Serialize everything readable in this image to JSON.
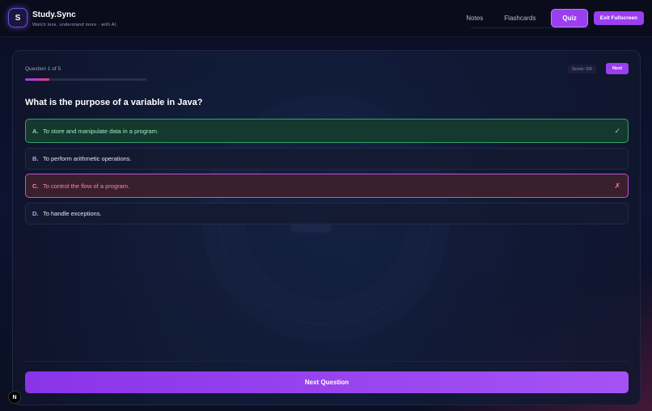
{
  "header": {
    "logo_letter": "S",
    "brand": "Study.Sync",
    "tagline": "Watch less, understand more - with AI.",
    "tabs": [
      {
        "label": "Notes",
        "active": false
      },
      {
        "label": "Flashcards",
        "active": false
      },
      {
        "label": "Quiz",
        "active": true
      }
    ],
    "exit_label": "Exit Fullscreen"
  },
  "quiz": {
    "counter": "Question 1 of 5",
    "progress_fraction": 0.2,
    "score": "Score: 0/5",
    "next_label": "Next",
    "question": "What is the purpose of a variable in Java?",
    "options": [
      {
        "letter": "A.",
        "text": "To store and manipulate data in a program.",
        "state": "correct",
        "mark": "✓"
      },
      {
        "letter": "B.",
        "text": "To perform arithmetic operations.",
        "state": "neutral",
        "mark": ""
      },
      {
        "letter": "C.",
        "text": "To control the flow of a program.",
        "state": "wrong",
        "mark": "✗"
      },
      {
        "letter": "D.",
        "text": "To handle exceptions.",
        "state": "neutral",
        "mark": ""
      }
    ],
    "next_question_label": "Next Question"
  },
  "footer": {
    "badge": "N"
  },
  "colors": {
    "accent": "#9a3ff0",
    "correct": "#2ea36a",
    "wrong": "#c150d9",
    "background": "#0b0d1f"
  }
}
